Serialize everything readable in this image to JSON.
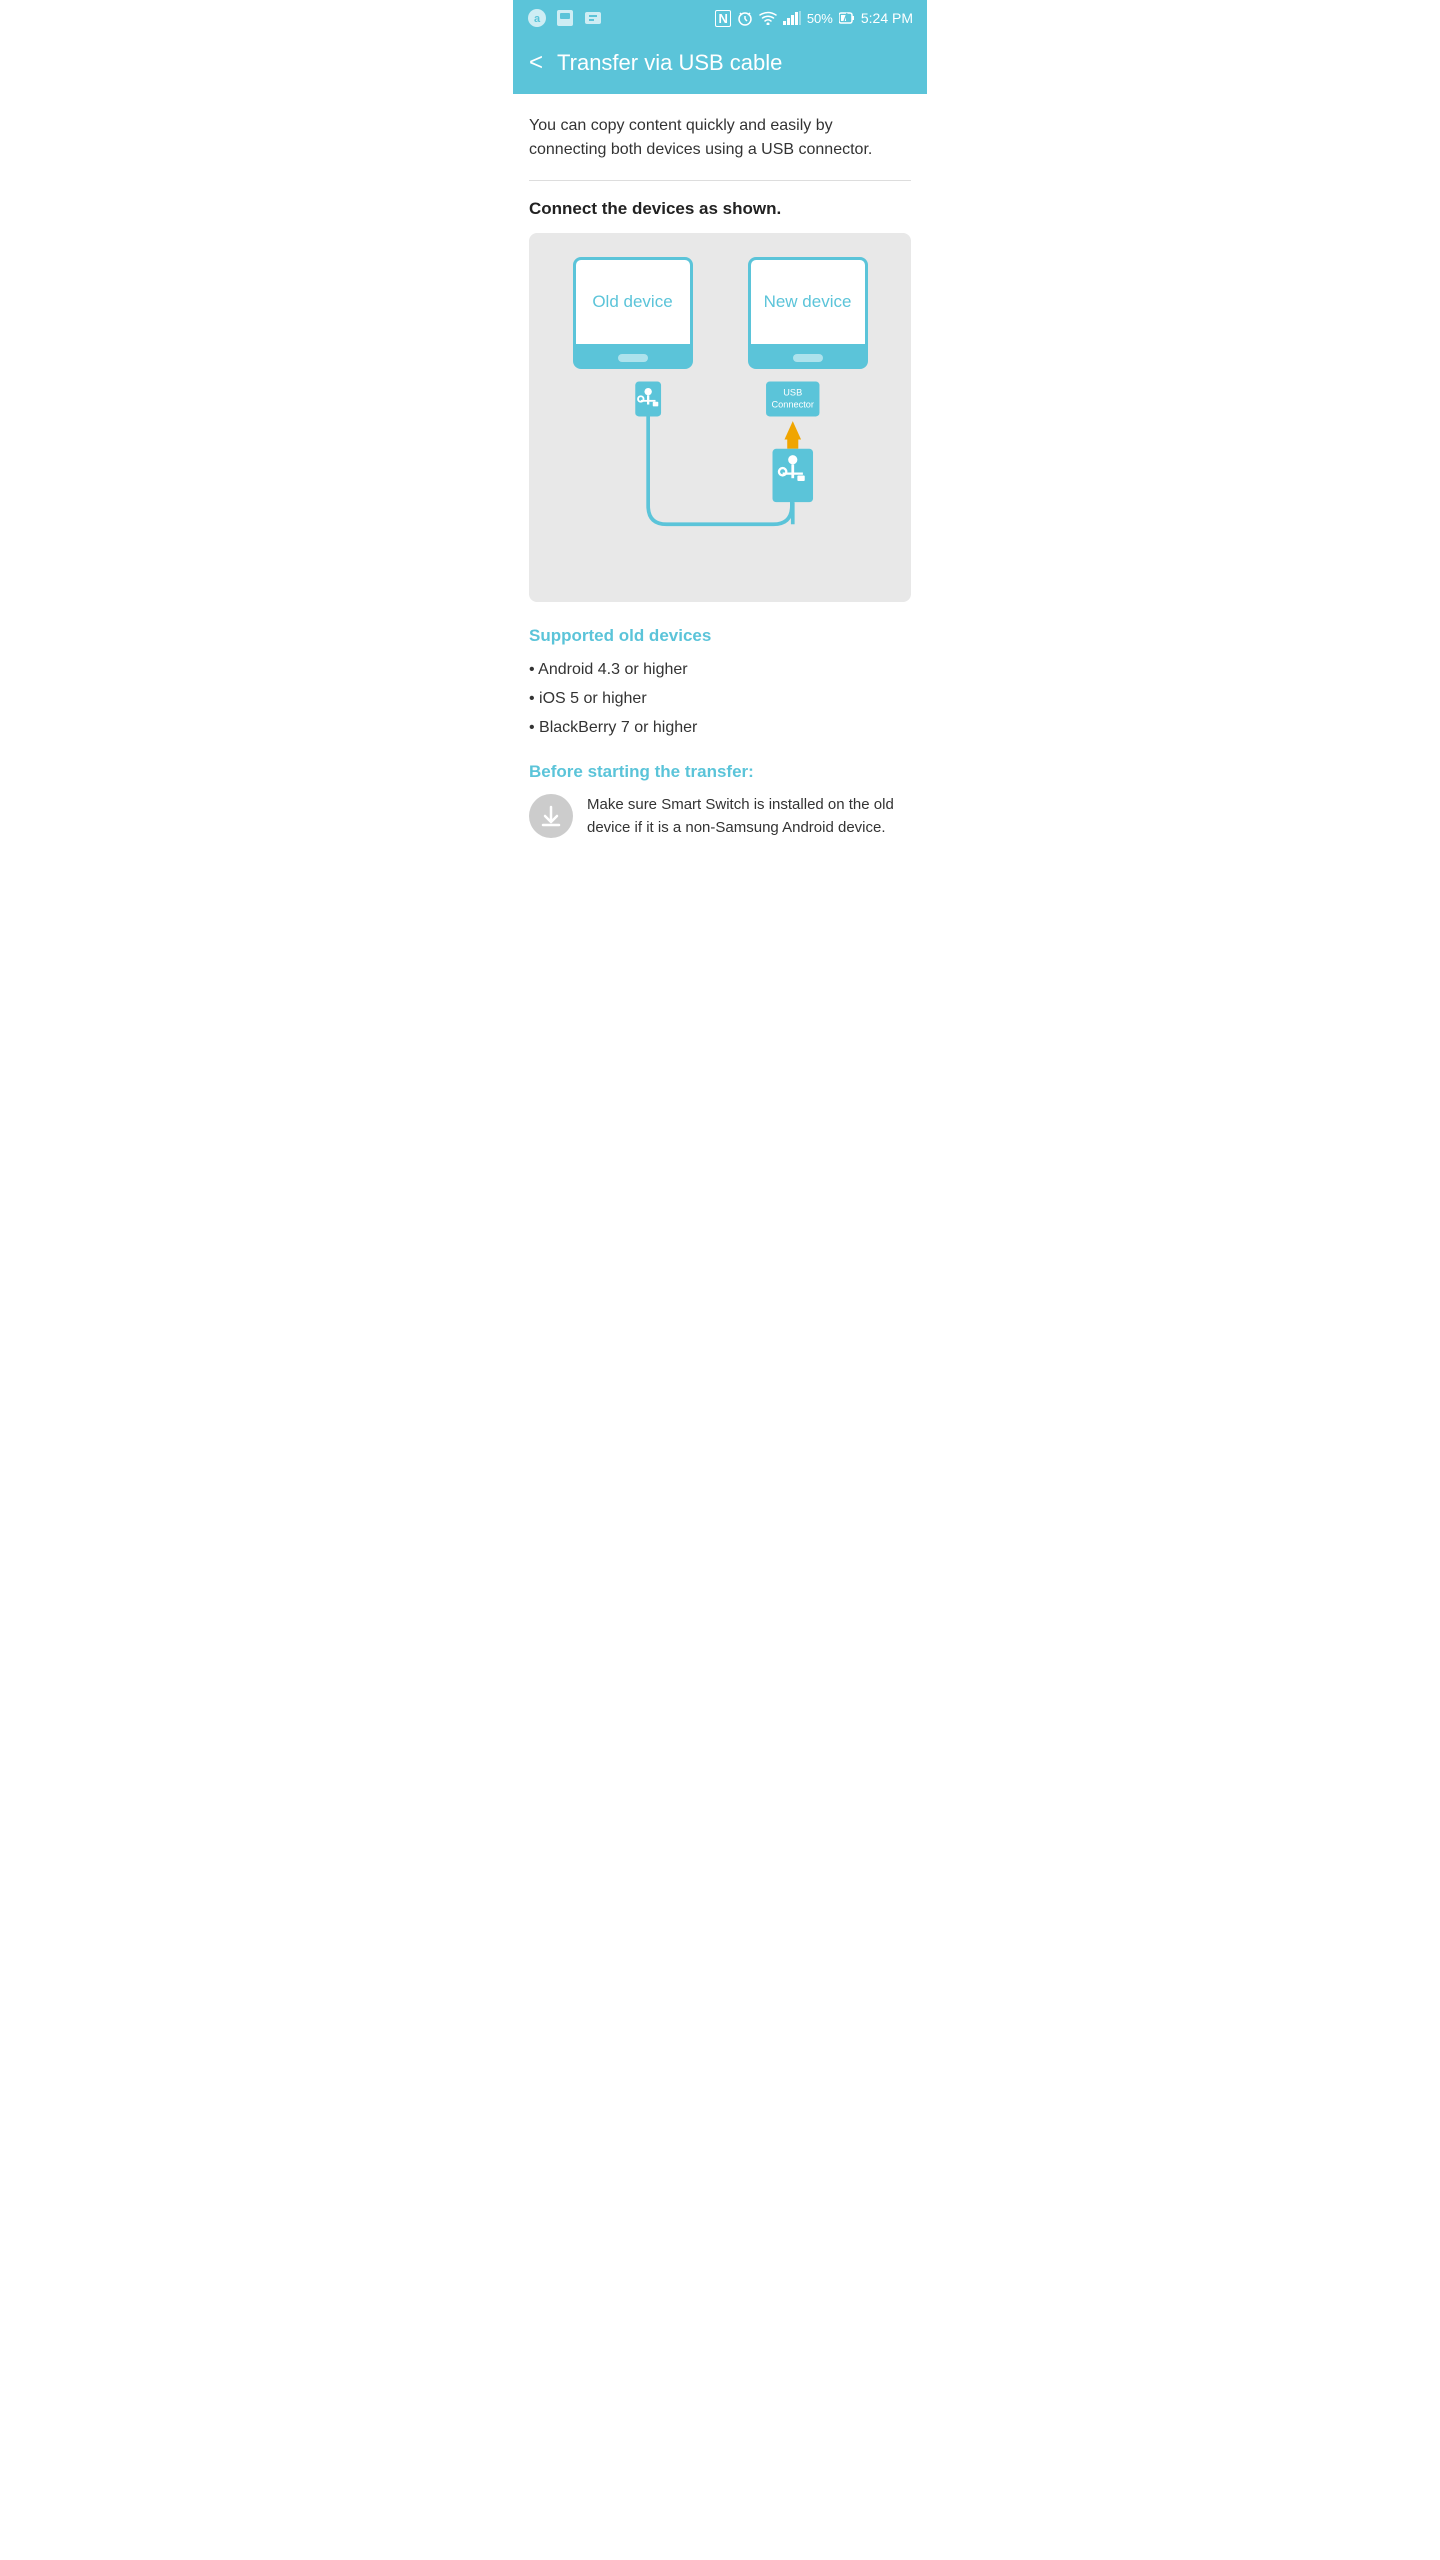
{
  "statusBar": {
    "time": "5:24 PM",
    "battery": "50%",
    "icons": [
      "N",
      "⏰",
      "wifi",
      "signal"
    ]
  },
  "header": {
    "backLabel": "<",
    "title": "Transfer via USB cable"
  },
  "main": {
    "description": "You can copy content quickly and easily by connecting both devices using a USB connector.",
    "connectHeading": "Connect the devices as shown.",
    "diagram": {
      "oldDeviceLabel": "Old device",
      "newDeviceLabel": "New device",
      "usbConnectorLabel": "USB\nConnector"
    },
    "supportedTitle": "Supported old devices",
    "supportedItems": [
      "Android 4.3 or higher",
      "iOS 5 or higher",
      "BlackBerry 7 or higher"
    ],
    "beforeTitle": "Before starting the transfer:",
    "beforeText": "Make sure Smart Switch is installed on the old device if it is a non-Samsung Android device."
  }
}
